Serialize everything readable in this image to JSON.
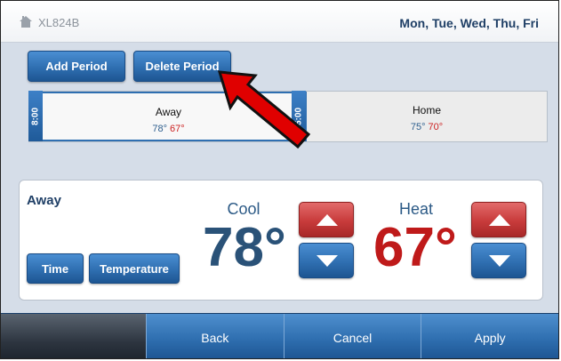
{
  "header": {
    "model": "XL824B",
    "days": "Mon, Tue, Wed, Thu, Fri",
    "home_icon": "house-icon"
  },
  "toolbar": {
    "add_period": "Add Period",
    "delete_period": "Delete Period"
  },
  "schedule": {
    "periods": [
      {
        "name": "Away",
        "start": "8:00",
        "cool": "78°",
        "heat": "67°",
        "selected": true
      },
      {
        "name": "Home",
        "start": "5:00",
        "cool": "75°",
        "heat": "70°",
        "selected": false
      }
    ]
  },
  "detail": {
    "title": "Away",
    "time_label": "Time",
    "temperature_label": "Temperature",
    "cool_label": "Cool",
    "cool_value": "78°",
    "heat_label": "Heat",
    "heat_value": "67°"
  },
  "footer": {
    "back": "Back",
    "cancel": "Cancel",
    "apply": "Apply"
  },
  "colors": {
    "accent_blue": "#2f6fb1",
    "heat_red": "#bf1a1a",
    "cool_navy": "#2a5278",
    "annotation_arrow": "#e00000"
  }
}
